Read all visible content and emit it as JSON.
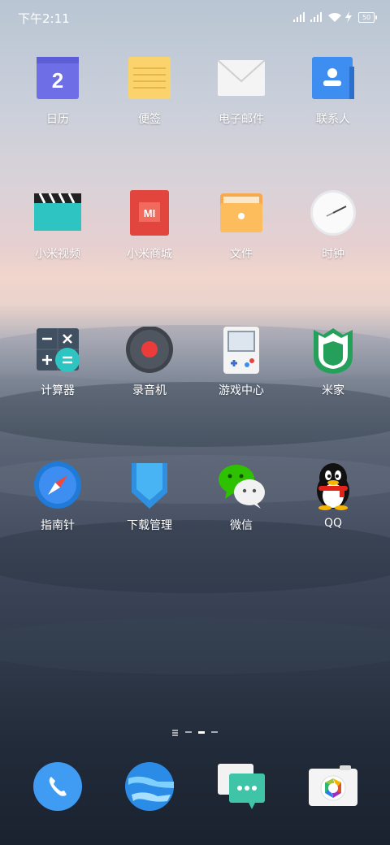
{
  "status": {
    "time": "下午2:11",
    "battery": "50"
  },
  "apps": [
    {
      "label": "日历"
    },
    {
      "label": "便签"
    },
    {
      "label": "电子邮件"
    },
    {
      "label": "联系人"
    },
    {
      "label": "小米视频"
    },
    {
      "label": "小米商城"
    },
    {
      "label": "文件"
    },
    {
      "label": "时钟"
    },
    {
      "label": "计算器"
    },
    {
      "label": "录音机"
    },
    {
      "label": "游戏中心"
    },
    {
      "label": "米家"
    },
    {
      "label": "指南针"
    },
    {
      "label": "下载管理"
    },
    {
      "label": "微信"
    },
    {
      "label": "QQ"
    }
  ],
  "calendar_day": "2",
  "mi_logo": "MI",
  "page_indicator": {
    "pages": 4,
    "current": 3
  },
  "colors": {
    "accent_blue": "#3d8ef0",
    "calendar_purple": "#6e6ee6",
    "video_teal": "#2ec4c2",
    "mall_red": "#e2453d"
  }
}
